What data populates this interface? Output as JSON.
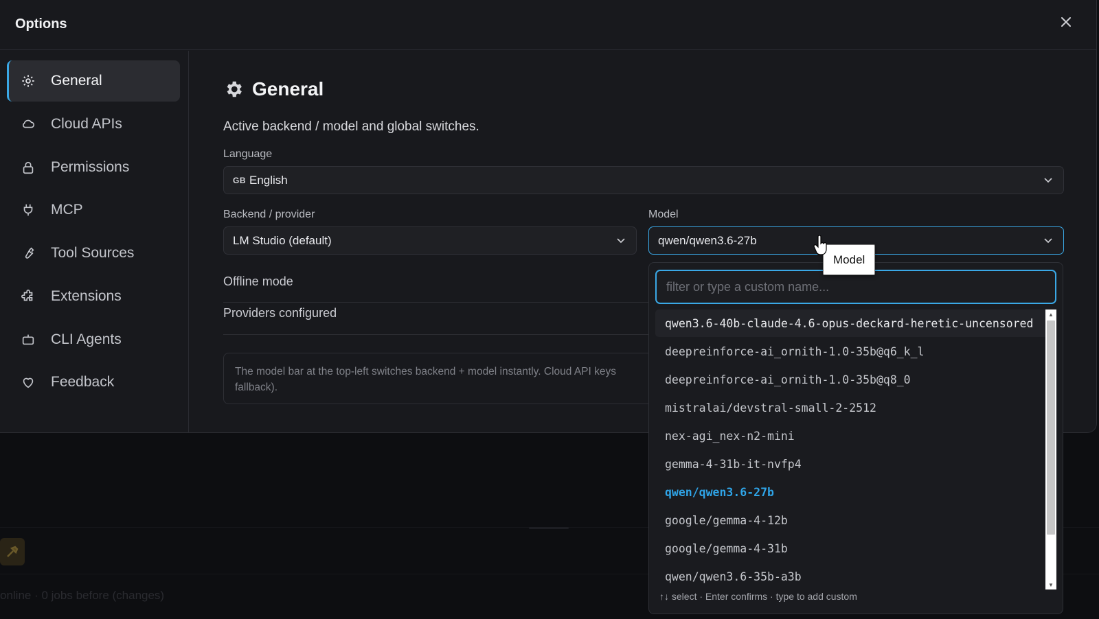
{
  "dialog": {
    "title": "Options",
    "close_icon": "close-icon"
  },
  "sidebar": {
    "items": [
      {
        "label": "General",
        "icon": "gear-icon",
        "active": true
      },
      {
        "label": "Cloud APIs",
        "icon": "cloud-icon"
      },
      {
        "label": "Permissions",
        "icon": "lock-icon"
      },
      {
        "label": "MCP",
        "icon": "plug-icon"
      },
      {
        "label": "Tool Sources",
        "icon": "wrench-icon"
      },
      {
        "label": "Extensions",
        "icon": "puzzle-icon"
      },
      {
        "label": "CLI Agents",
        "icon": "robot-icon"
      },
      {
        "label": "Feedback",
        "icon": "heart-icon"
      }
    ]
  },
  "general": {
    "title": "General",
    "description": "Active backend / model and global switches.",
    "language": {
      "label": "Language",
      "flag": "GB",
      "value": "English"
    },
    "backend": {
      "label": "Backend / provider",
      "value": "LM Studio (default)"
    },
    "model": {
      "label": "Model",
      "value": "qwen/qwen3.6-27b"
    },
    "offline_mode_label": "Offline mode",
    "providers_configured_label": "Providers configured",
    "info_text": "The model bar at the top-left switches backend + model instantly. Cloud API keys fallback)."
  },
  "tooltip": {
    "text": "Model"
  },
  "model_dropdown": {
    "filter_placeholder": "filter or type a custom name...",
    "options": [
      "qwen3.6-40b-claude-4.6-opus-deckard-heretic-uncensored",
      "deepreinforce-ai_ornith-1.0-35b@q6_k_l",
      "deepreinforce-ai_ornith-1.0-35b@q8_0",
      "mistralai/devstral-small-2-2512",
      "nex-agi_nex-n2-mini",
      "gemma-4-31b-it-nvfp4",
      "qwen/qwen3.6-27b",
      "google/gemma-4-12b",
      "google/gemma-4-31b",
      "qwen/qwen3.6-35b-a3b"
    ],
    "selected": "qwen/qwen3.6-27b",
    "hint": "↑↓ select · Enter confirms · type to add custom"
  },
  "background": {
    "status_text": "online · 0 jobs before (changes)"
  },
  "colors": {
    "accent": "#3aa8e6",
    "selected_option": "#2fa4e7",
    "dialog_bg": "#18191d"
  }
}
